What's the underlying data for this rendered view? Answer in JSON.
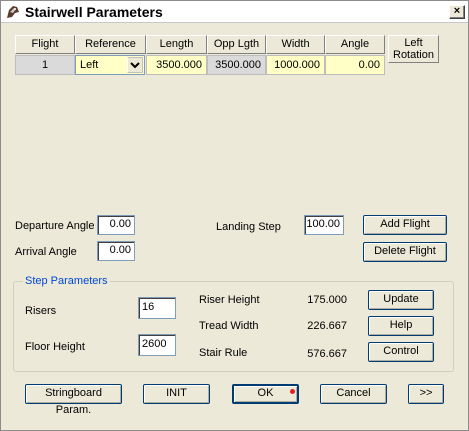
{
  "window": {
    "title": "Stairwell Parameters",
    "close_glyph": "×"
  },
  "grid": {
    "headers": [
      "Flight",
      "Reference",
      "Length",
      "Opp Lgth",
      "Width",
      "Angle",
      "Left\nRotation"
    ],
    "header_left_rotation_line1": "Left",
    "header_left_rotation_line2": "Rotation",
    "row": {
      "flight": "1",
      "reference": "Left",
      "length": "3500.000",
      "opp_length": "3500.000",
      "width": "1000.000",
      "angle": "0.00"
    }
  },
  "flight_controls": {
    "departure_angle_label": "Departure Angle",
    "departure_angle_value": "0.00",
    "arrival_angle_label": "Arrival Angle",
    "arrival_angle_value": "0.00",
    "landing_step_label": "Landing Step",
    "landing_step_value": "100.00",
    "add_flight": "Add Flight",
    "delete_flight": "Delete Flight"
  },
  "step_parameters": {
    "title": "Step Parameters",
    "risers_label": "Risers",
    "risers_value": "16",
    "floor_height_label": "Floor Height",
    "floor_height_value": "2600",
    "riser_height_label": "Riser Height",
    "riser_height_value": "175.000",
    "tread_width_label": "Tread Width",
    "tread_width_value": "226.667",
    "stair_rule_label": "Stair Rule",
    "stair_rule_value": "576.667",
    "update": "Update",
    "help": "Help",
    "control": "Control"
  },
  "footer": {
    "stringboard": "Stringboard Param.",
    "init": "INIT",
    "ok": "OK",
    "cancel": "Cancel",
    "more": ">>"
  },
  "colors": {
    "dialog_bg": "#ECE9D8",
    "input_yellow": "#FFFFC6",
    "readonly_gray": "#DADADA",
    "group_title_blue": "#0046d5",
    "ok_dot": "#e02020"
  },
  "icons": {
    "title": "stair-app-icon",
    "dropdown": "chevron-down-icon"
  }
}
